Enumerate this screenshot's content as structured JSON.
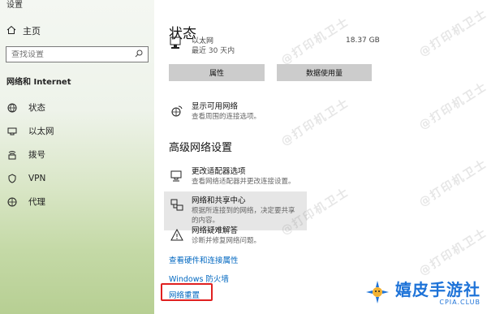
{
  "window": {
    "title": "设置"
  },
  "sidebar": {
    "home_label": "主页",
    "search_placeholder": "查找设置",
    "section_title": "网络和 Internet",
    "items": [
      {
        "label": "状态",
        "icon": "status-icon"
      },
      {
        "label": "以太网",
        "icon": "ethernet-icon"
      },
      {
        "label": "拨号",
        "icon": "dialup-icon"
      },
      {
        "label": "VPN",
        "icon": "vpn-icon"
      },
      {
        "label": "代理",
        "icon": "proxy-icon"
      }
    ]
  },
  "main": {
    "title": "状态",
    "connection": {
      "name": "以太网",
      "since": "最近 30 天内",
      "data_used": "18.37 GB"
    },
    "buttons": {
      "properties": "属性",
      "data_usage": "数据使用量"
    },
    "show_networks": {
      "title": "显示可用网络",
      "desc": "查看周围的连接选项。"
    },
    "advanced_heading": "高级网络设置",
    "adapter_options": {
      "title": "更改适配器选项",
      "desc": "查看网络适配器并更改连接设置。"
    },
    "sharing_center": {
      "title": "网络和共享中心",
      "desc": "根据所连接到的网络，决定要共享的内容。"
    },
    "troubleshooter": {
      "title": "网络疑难解答",
      "desc": "诊断并修复网络问题。"
    },
    "links": {
      "hardware_props": "查看硬件和连接属性",
      "firewall": "Windows 防火墙",
      "network_reset": "网络重置"
    }
  },
  "watermark_text": "@打印机卫士",
  "brand": {
    "name": "嬉皮手游社",
    "sub": "CPIA.CLUB"
  },
  "colors": {
    "link": "#0067c0",
    "highlight_box": "#e02020",
    "button_bg": "#cccccc",
    "brand": "#1e73d8"
  }
}
